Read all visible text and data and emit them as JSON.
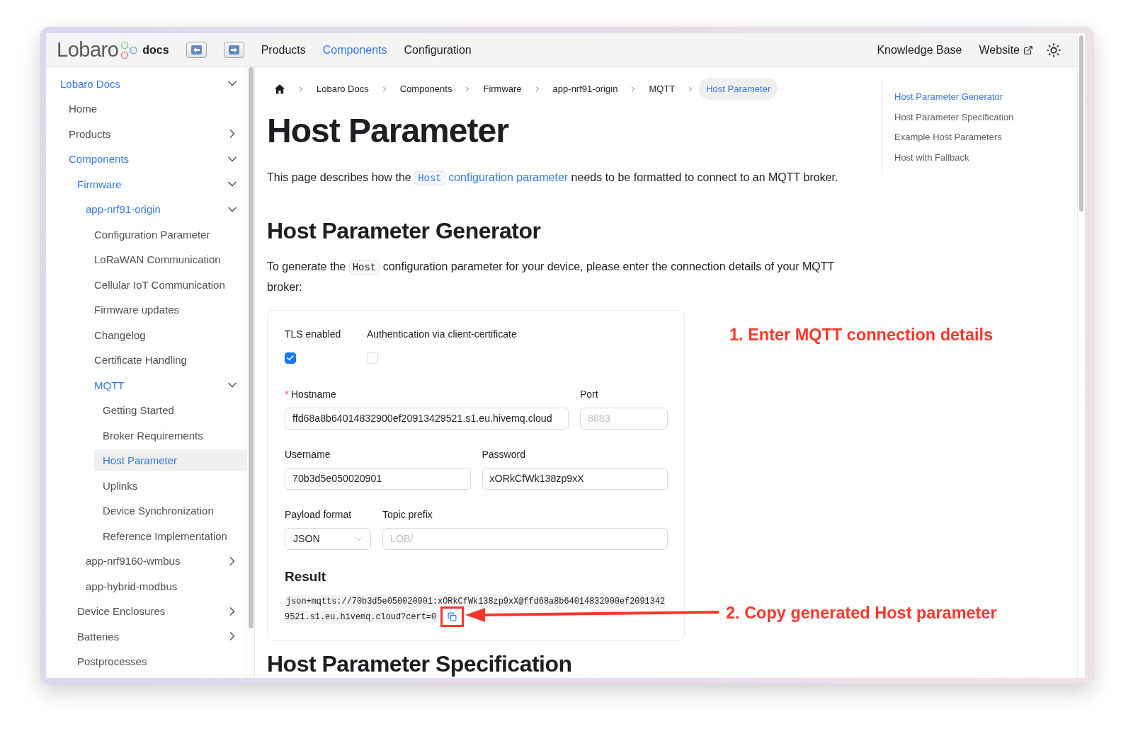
{
  "header": {
    "logo_text": "Lobaro",
    "logo_suffix": "docs",
    "nav": [
      {
        "label": "Products",
        "selected": false
      },
      {
        "label": "Components",
        "selected": true
      },
      {
        "label": "Configuration",
        "selected": false
      }
    ],
    "links": [
      {
        "label": "Knowledge Base",
        "external": false
      },
      {
        "label": "Website",
        "external": true
      }
    ]
  },
  "sidebar": {
    "items": [
      {
        "label": "Lobaro Docs",
        "selected": false,
        "expanded": true,
        "children": [
          {
            "label": "Home",
            "selected": false
          },
          {
            "label": "Products",
            "selected": false,
            "expanded": false
          },
          {
            "label": "Components",
            "selected": false,
            "expanded": true,
            "children": [
              {
                "label": "Firmware",
                "selected": false,
                "expanded": true,
                "children": [
                  {
                    "label": "app-nrf91-origin",
                    "selected": false,
                    "expanded": true,
                    "children": [
                      {
                        "label": "Configuration Parameter",
                        "selected": false
                      },
                      {
                        "label": "LoRaWAN Communication",
                        "selected": false
                      },
                      {
                        "label": "Cellular IoT Communication",
                        "selected": false
                      },
                      {
                        "label": "Firmware updates",
                        "selected": false
                      },
                      {
                        "label": "Changelog",
                        "selected": false
                      },
                      {
                        "label": "Certificate Handling",
                        "selected": false
                      },
                      {
                        "label": "MQTT",
                        "selected": false,
                        "expanded": true,
                        "children": [
                          {
                            "label": "Getting Started",
                            "selected": false
                          },
                          {
                            "label": "Broker Requirements",
                            "selected": false
                          },
                          {
                            "label": "Host Parameter",
                            "selected": true
                          },
                          {
                            "label": "Uplinks",
                            "selected": false
                          },
                          {
                            "label": "Device Synchronization",
                            "selected": false
                          },
                          {
                            "label": "Reference Implementation",
                            "selected": false
                          }
                        ]
                      }
                    ]
                  },
                  {
                    "label": "app-nrf9160-wmbus",
                    "selected": false,
                    "expanded": false
                  },
                  {
                    "label": "app-hybrid-modbus",
                    "selected": false
                  }
                ]
              },
              {
                "label": "Device Enclosures",
                "selected": false,
                "expanded": false
              },
              {
                "label": "Batteries",
                "selected": false,
                "expanded": false
              },
              {
                "label": "Postprocesses",
                "selected": false
              }
            ]
          }
        ]
      }
    ]
  },
  "breadcrumb": {
    "home": true,
    "items": [
      {
        "label": "Lobaro Docs",
        "selected": false
      },
      {
        "label": "Components",
        "selected": false
      },
      {
        "label": "Firmware",
        "selected": false
      },
      {
        "label": "app-nrf91-origin",
        "selected": false
      },
      {
        "label": "MQTT",
        "selected": false
      },
      {
        "label": "Host Parameter",
        "selected": true
      }
    ]
  },
  "title": "Host Parameter",
  "intro": [
    {
      "kind": "text",
      "text": "This page describes how the "
    },
    {
      "kind": "link_code",
      "text": "Host"
    },
    {
      "kind": "link",
      "text": " configuration parameter"
    },
    {
      "kind": "text",
      "text": " needs to be formatted to connect to an MQTT broker."
    }
  ],
  "generator": {
    "heading": "Host Parameter Generator",
    "text": [
      {
        "kind": "text",
        "text": "To generate the "
      },
      {
        "kind": "code",
        "text": "Host"
      },
      {
        "kind": "text",
        "text": " configuration parameter for your device, please enter the connection details of your MQTT broker:"
      }
    ],
    "checkboxes": [
      {
        "label": "TLS enabled",
        "checked": true
      },
      {
        "label": "Authentication via client-certificate",
        "checked": false
      }
    ],
    "field_rows": [
      [
        {
          "label": "Hostname",
          "required": true,
          "kind": "text",
          "value": "ffd68a8b64014832900ef20913429521.s1.eu.hivemq.cloud"
        },
        {
          "label": "Port",
          "required": false,
          "kind": "text",
          "placeholder": "8883"
        }
      ],
      [
        {
          "label": "Username",
          "required": false,
          "kind": "text",
          "value": "70b3d5e050020901"
        },
        {
          "label": "Password",
          "required": false,
          "kind": "text",
          "value": "xORkCfWk138zp9xX"
        }
      ],
      [
        {
          "label": "Payload format",
          "required": false,
          "kind": "select",
          "value": "JSON"
        },
        {
          "label": "Topic prefix",
          "required": false,
          "kind": "text",
          "placeholder": "LOB/"
        }
      ]
    ],
    "result": {
      "heading": "Result",
      "value": "json+mqtts://70b3d5e050020901:xORkCfWk138zp9xX@ffd68a8b64014832900ef20913429521.s1.eu.hivemq.cloud?cert=0"
    }
  },
  "next_section": {
    "heading": "Host Parameter Specification"
  },
  "toc": [
    {
      "label": "Host Parameter Generator",
      "selected": true
    },
    {
      "label": "Host Parameter Specification",
      "selected": false
    },
    {
      "label": "Example Host Parameters",
      "selected": false
    },
    {
      "label": "Host with Fallback",
      "selected": false
    }
  ],
  "annotations": [
    {
      "text": "1. Enter MQTT connection details",
      "arrow": false
    },
    {
      "text": "2. Copy generated Host parameter",
      "arrow": true
    }
  ]
}
